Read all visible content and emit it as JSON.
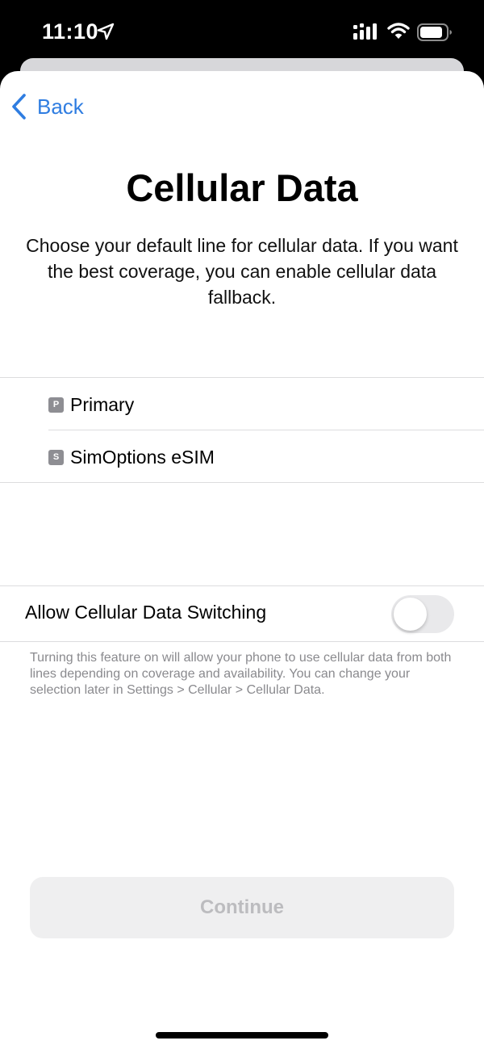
{
  "status_bar": {
    "time": "11:10",
    "icons": [
      "location-arrow-icon",
      "signal-icon",
      "wifi-icon",
      "battery-icon"
    ]
  },
  "nav": {
    "back_label": "Back"
  },
  "header": {
    "title": "Cellular Data",
    "subtitle": "Choose your default line for cellular data. If you want the best coverage, you can enable cellular data fallback."
  },
  "lines": [
    {
      "badge": "P",
      "label": "Primary"
    },
    {
      "badge": "S",
      "label": "SimOptions eSIM"
    }
  ],
  "switching": {
    "label": "Allow Cellular Data Switching",
    "enabled": false,
    "footnote": "Turning this feature on will allow your phone to use cellular data from both lines depending on coverage and availability. You can change your selection later in Settings > Cellular > Cellular Data."
  },
  "footer": {
    "continue_label": "Continue"
  },
  "colors": {
    "accent": "#2f7de1",
    "badge": "#8e8e93",
    "toggle_off": "#e9e9eb",
    "button_disabled_bg": "#efeff0",
    "button_disabled_text": "#bcbcbf"
  }
}
